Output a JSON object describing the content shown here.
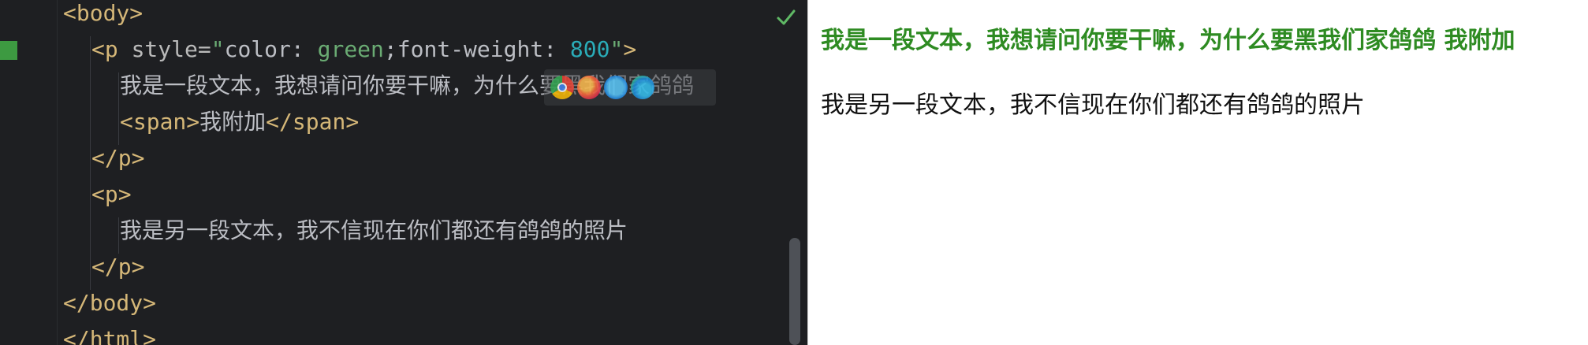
{
  "editor": {
    "lines": [
      {
        "open": "<body>"
      },
      {
        "p_open": "<p",
        "attr_name": " style=",
        "q1": "\"",
        "prop1": "color: ",
        "val1": "green",
        "sep": ";",
        "prop2": "font-weight: ",
        "val2": "800",
        "q2": "\"",
        "close": ">"
      },
      {
        "text": "我是一段文本，我想请问你要干嘛，为什么要黑我们家鸽鸽"
      },
      {
        "span_open": "<span>",
        "text": "我附加",
        "span_close": "</span>"
      },
      {
        "close": "</p>"
      },
      {
        "open": "<p>"
      },
      {
        "text": "我是另一段文本，我不信现在你们都还有鸽鸽的照片"
      },
      {
        "close": "</p>"
      },
      {
        "close": "</body>"
      },
      {
        "close": "</html>"
      }
    ],
    "check_icon": "check-icon",
    "browser_icons": [
      "chrome-icon",
      "firefox-icon",
      "safari-icon",
      "edge-icon"
    ],
    "colors": {
      "background": "#1e1f22",
      "tag": "#d5b778",
      "string": "#6aab73",
      "number": "#2aacb8",
      "change_marker": "#3d9a41"
    }
  },
  "preview": {
    "paragraph1": "我是一段文本，我想请问你要干嘛，为什么要黑我们家鸽鸽 我附加",
    "paragraph2": "我是另一段文本，我不信现在你们都还有鸽鸽的照片",
    "colors": {
      "paragraph1": "#2e8b22",
      "paragraph2": "#111111"
    }
  }
}
